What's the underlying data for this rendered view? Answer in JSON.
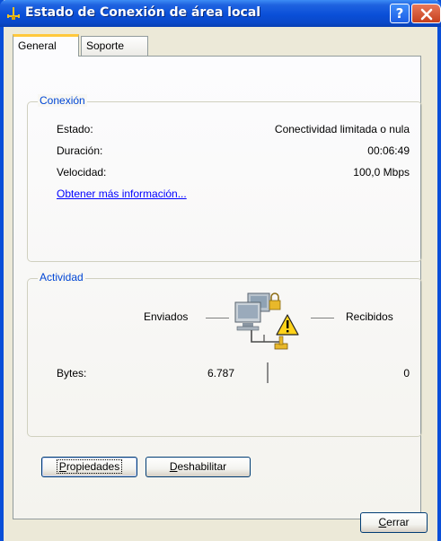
{
  "window": {
    "title": "Estado de Conexión de área local",
    "help_label": "?",
    "colors": {
      "titlebar": "#0a4fd8",
      "group_title": "#0046d5",
      "link": "#0000ff",
      "face": "#ece9d8"
    }
  },
  "tabs": [
    {
      "label": "General",
      "selected": true
    },
    {
      "label": "Soporte",
      "selected": false
    }
  ],
  "connection": {
    "title": "Conexión",
    "rows": [
      {
        "label": "Estado:",
        "value": "Conectividad limitada o nula"
      },
      {
        "label": "Duración:",
        "value": "00:06:49"
      },
      {
        "label": "Velocidad:",
        "value": "100,0 Mbps"
      }
    ],
    "link": "Obtener más información..."
  },
  "activity": {
    "title": "Actividad",
    "sent_label": "Enviados",
    "received_label": "Recibidos",
    "bytes_label": "Bytes:",
    "bytes_sent": "6.787",
    "bytes_received": "0",
    "icon": "network-warning-icon"
  },
  "buttons": {
    "properties": {
      "accel": "P",
      "rest": "ropiedades"
    },
    "disable": {
      "accel": "D",
      "rest": "eshabilitar"
    },
    "close": {
      "accel": "C",
      "rest": "errar"
    }
  }
}
